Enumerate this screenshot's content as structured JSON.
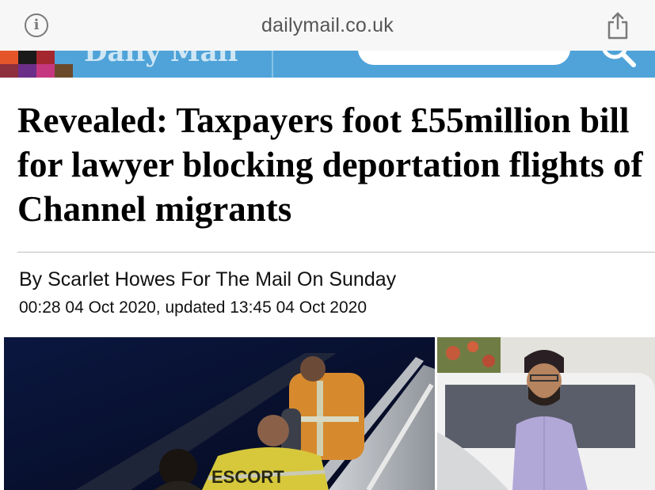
{
  "browser": {
    "url": "dailymail.co.uk",
    "icons": [
      "info-icon",
      "share-icon"
    ]
  },
  "masthead": {
    "logo": "Daily Mail",
    "icons": [
      "search-icon"
    ],
    "colors": {
      "bar": "#4fa3d8"
    }
  },
  "article": {
    "headline": "Revealed: Taxpayers foot £55million bill for lawyer blocking deportation flights of Channel migrants",
    "byline": "By Scarlet Howes For The Mail On Sunday",
    "dateline": "00:28 04 Oct 2020, updated 13:45 04 Oct 2020"
  },
  "photos": {
    "left_vest_text": "ESCORT"
  }
}
